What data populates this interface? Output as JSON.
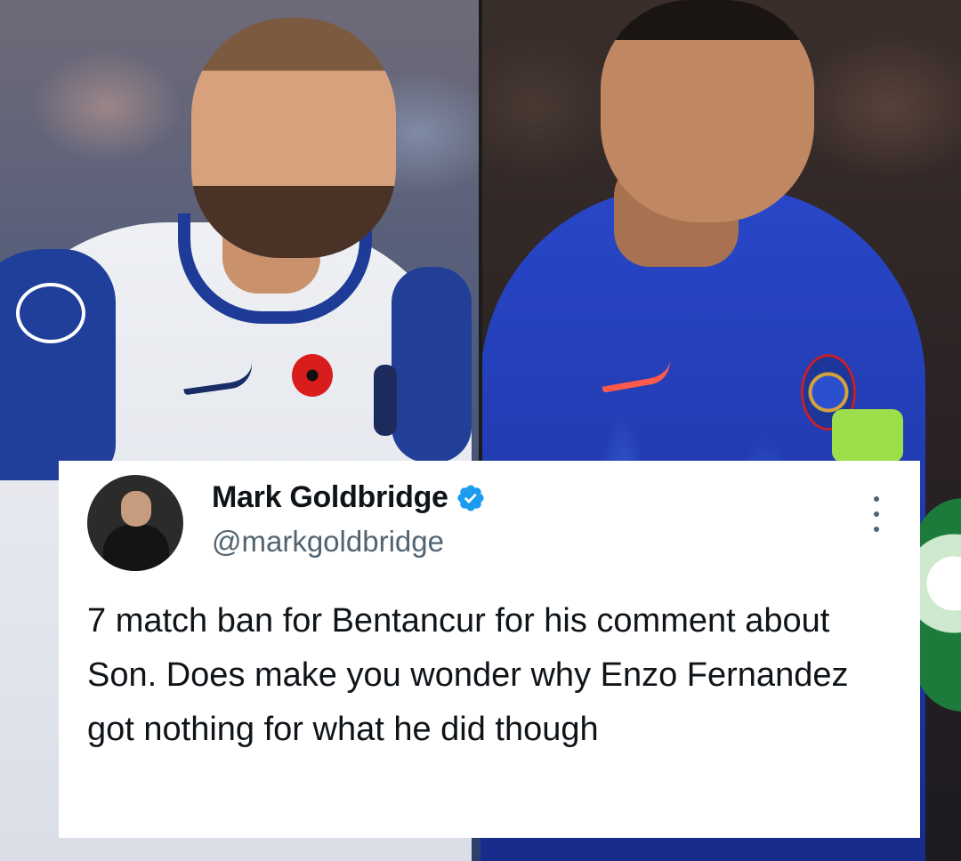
{
  "tweet": {
    "author_name": "Mark Goldbridge",
    "author_handle": "@markgoldbridge",
    "text": "7 match ban for Bentancur for his comment about Son. Does make you wonder why Enzo Fernandez got nothing for what he did though"
  },
  "icons": {
    "verified": "verified-badge-icon",
    "more": "more-options-icon"
  },
  "colors": {
    "verified_blue": "#1d9bf0",
    "text_primary": "#0f1419",
    "text_secondary": "#536471"
  }
}
